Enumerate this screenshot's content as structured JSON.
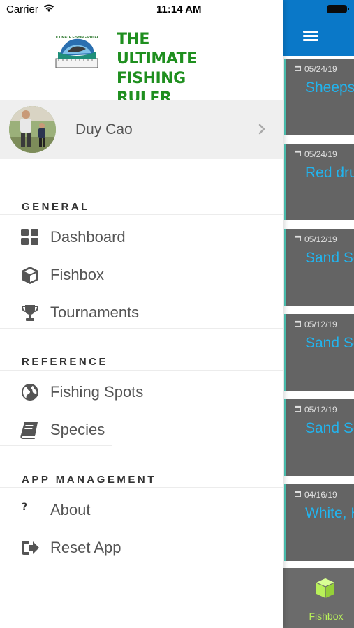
{
  "status_bar": {
    "carrier": "Carrier",
    "time": "11:14 AM"
  },
  "header": {
    "app_title": "THE ULTIMATE FISHING RULER",
    "logo_text": "ULTIMATE FISHING RULER"
  },
  "profile": {
    "name": "Duy Cao"
  },
  "sections": [
    {
      "title": "GENERAL",
      "items": [
        {
          "label": "Dashboard",
          "icon": "dashboard-icon"
        },
        {
          "label": "Fishbox",
          "icon": "cube-icon"
        },
        {
          "label": "Tournaments",
          "icon": "trophy-icon"
        }
      ]
    },
    {
      "title": "REFERENCE",
      "items": [
        {
          "label": "Fishing Spots",
          "icon": "globe-icon"
        },
        {
          "label": "Species",
          "icon": "book-icon"
        }
      ]
    },
    {
      "title": "APP MANAGEMENT",
      "items": [
        {
          "label": "About",
          "icon": "question-icon"
        },
        {
          "label": "Reset App",
          "icon": "sign-out-icon"
        }
      ]
    }
  ],
  "catches": [
    {
      "date": "05/24/19",
      "name": "Sheepshead"
    },
    {
      "date": "05/24/19",
      "name": "Red drum"
    },
    {
      "date": "05/12/19",
      "name": "Sand Seatrout"
    },
    {
      "date": "05/12/19",
      "name": "Sand Seatrout"
    },
    {
      "date": "05/12/19",
      "name": "Sand Seatrout"
    },
    {
      "date": "04/16/19",
      "name": "White, Hake"
    }
  ],
  "tabbar": {
    "active_tab": "Fishbox"
  },
  "colors": {
    "header_blue": "#0a78c8",
    "title_green": "#1f8f1f",
    "catch_text_blue": "#22b4ee",
    "card_accent": "#4ec9b8",
    "tab_active": "#b8f05a"
  }
}
